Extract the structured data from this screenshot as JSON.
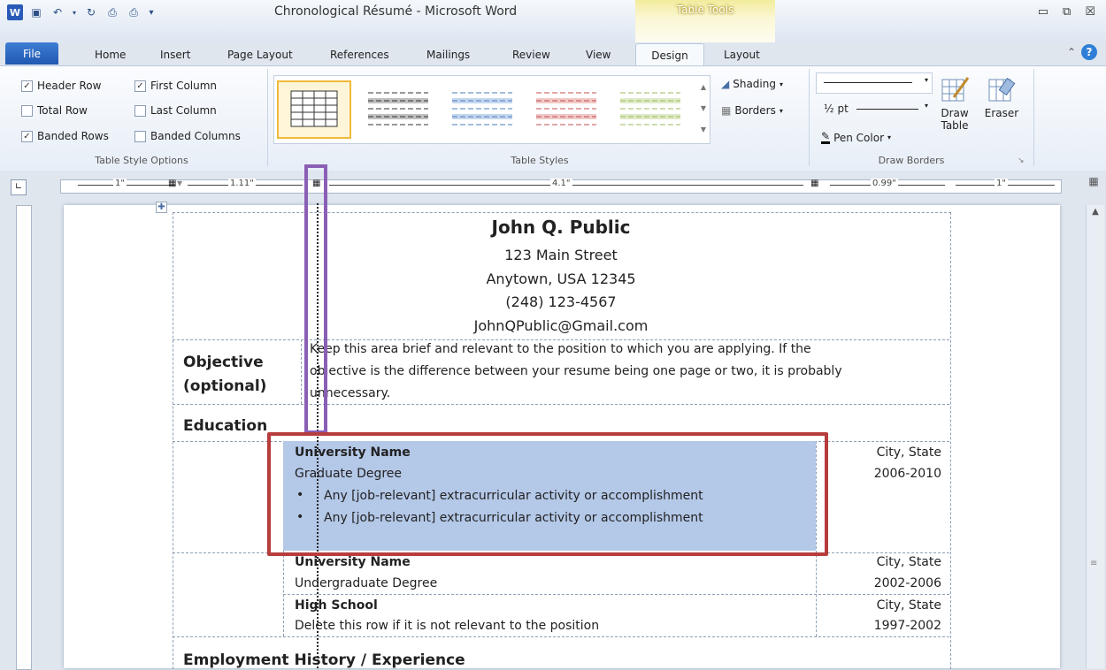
{
  "window": {
    "title": "Chronological Résumé  -  Microsoft Word",
    "context_group": "Table Tools",
    "min": "▭",
    "max": "⧉",
    "close": "☒"
  },
  "tabs": [
    "File",
    "Home",
    "Insert",
    "Page Layout",
    "References",
    "Mailings",
    "Review",
    "View",
    "Design",
    "Layout"
  ],
  "ribbon": {
    "style_options": {
      "header_row": "Header Row",
      "first_column": "First Column",
      "total_row": "Total Row",
      "last_column": "Last Column",
      "banded_rows": "Banded Rows",
      "banded_columns": "Banded Columns",
      "label": "Table Style Options",
      "checked": {
        "header_row": true,
        "first_column": true,
        "total_row": false,
        "last_column": false,
        "banded_rows": true,
        "banded_columns": false
      }
    },
    "table_styles": {
      "label": "Table Styles",
      "shading": "Shading",
      "borders": "Borders"
    },
    "draw_borders": {
      "label": "Draw Borders",
      "weight": "½ pt",
      "pen_color": "Pen Color",
      "draw_table": "Draw\nTable",
      "eraser": "Eraser"
    }
  },
  "ruler": {
    "m1": "1\"",
    "m2": "1.11\"",
    "m3": "4.1\"",
    "m4": "0.99\"",
    "m5": "1\""
  },
  "resume": {
    "name": "John Q. Public",
    "street": "123 Main Street",
    "city": "Anytown, USA 12345",
    "phone": "(248) 123-4567",
    "email": "JohnQPublic@Gmail.com",
    "objective_label_1": "Objective",
    "objective_label_2": "(optional)",
    "objective_text_1": "Keep this area brief and relevant to the position to which you are applying. If the",
    "objective_text_2": "objective is the difference between your resume being one page or two, it is probably",
    "objective_text_3": "unnecessary.",
    "education_label": "Education",
    "edu": [
      {
        "school": "University Name",
        "degree": "Graduate Degree",
        "location": "City, State",
        "years": "2006-2010",
        "bullets": [
          "Any [job-relevant] extracurricular  activity or accomplishment",
          "Any [job-relevant] extracurricular  activity or accomplishment"
        ]
      },
      {
        "school": "University Name",
        "degree": "Undergraduate  Degree",
        "location": "City, State",
        "years": "2002-2006"
      },
      {
        "school": "High School",
        "degree": "Delete this row if it is not relevant to the position",
        "location": "City, State",
        "years": "1997-2002"
      }
    ],
    "employment_label": "Employment History / Experience"
  }
}
